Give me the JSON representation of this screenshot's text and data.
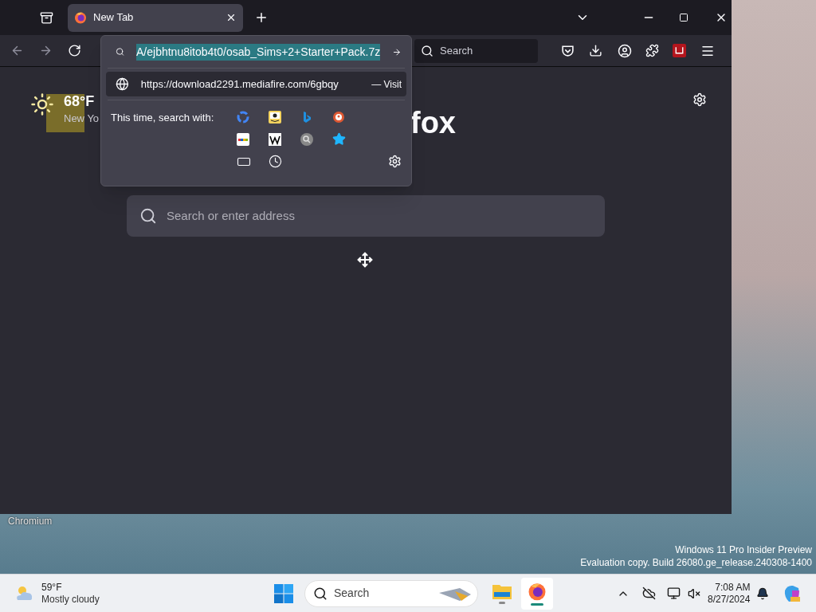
{
  "tabs": [
    {
      "title": "New Tab",
      "selected": true
    }
  ],
  "toolbar": {
    "search_placeholder": "Search"
  },
  "urlbar": {
    "value": "A/ejbhtnu8itob4t0/osab_Sims+2+Starter+Pack.7z",
    "selected": true
  },
  "suggestion": {
    "url": "https://download2291.mediafire.com/6gbqy",
    "action": "— Visit",
    "selected": true
  },
  "search_with": {
    "label": "This time, search with:"
  },
  "weather": {
    "temp": "68°F",
    "location": "New Yo"
  },
  "logo_text": "fox",
  "page_search": {
    "placeholder": "Search or enter address"
  },
  "desktop": {
    "app_label": "Chromium",
    "watermark": [
      "Windows 11 Pro Insider Preview",
      "Evaluation copy. Build 26080.ge_release.240308-1400"
    ]
  },
  "taskbar": {
    "weather": {
      "temp": "59°F",
      "condition": "Mostly cloudy"
    },
    "search_placeholder": "Search",
    "apps": [
      {
        "kind": "explorer",
        "selected": false
      },
      {
        "kind": "firefox",
        "selected": true
      }
    ],
    "clock": {
      "time": "7:08 AM",
      "date": "8/27/2024"
    }
  }
}
